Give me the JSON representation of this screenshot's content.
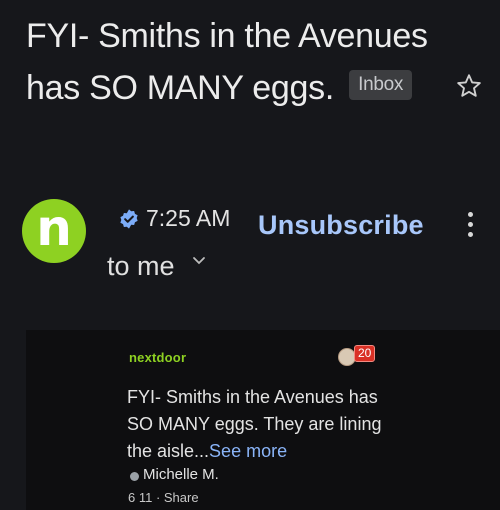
{
  "email": {
    "subject": "FYI- Smiths in the Avenues has SO MANY eggs.",
    "folder_badge": "Inbox",
    "sender_avatar_letter": "n",
    "time": "7:25 AM",
    "unsubscribe_label": "Unsubscribe",
    "recipient": "to me",
    "icons": {
      "star": "star-outline-icon",
      "verified": "verified-badge-icon",
      "more": "more-vert-icon",
      "expand": "chevron-down-icon"
    },
    "colors": {
      "background": "#16171b",
      "avatar": "#8ed122",
      "link": "#a8c7fa"
    }
  },
  "card": {
    "brand": "nextdoor",
    "notification_count": "20",
    "preview_text": "FYI- Smiths in the Avenues has SO MANY eggs. They are lining the aisle...",
    "see_more": "See more",
    "author": "Michelle M.",
    "stats": "6 11 · Share"
  }
}
